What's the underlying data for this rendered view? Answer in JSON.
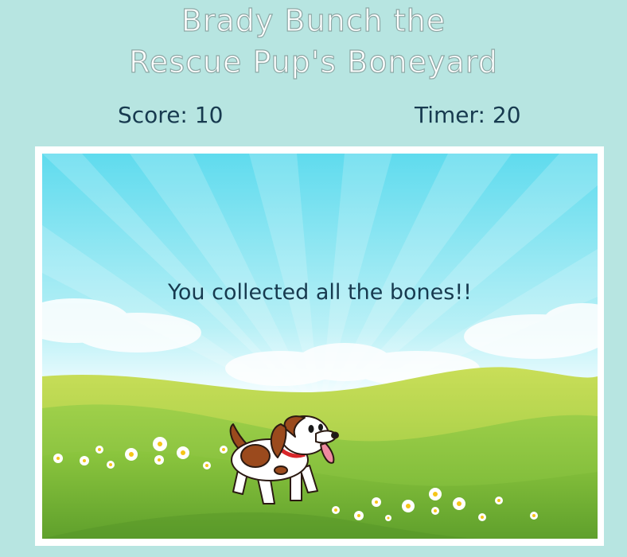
{
  "header": {
    "title_line1": "Brady Bunch the",
    "title_line2": "Rescue Pup's Boneyard"
  },
  "hud": {
    "score_label": "Score: 10",
    "timer_label": "Timer: 20"
  },
  "game": {
    "message": "You collected all the bones!!",
    "colors": {
      "page_bg": "#b7e5e1",
      "text": "#173a4f",
      "sky": "#6fdcef",
      "grass": "#8cc53e"
    }
  }
}
